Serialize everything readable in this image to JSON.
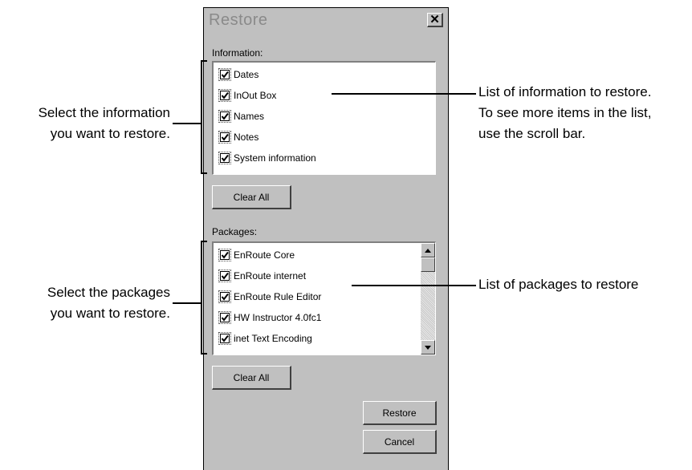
{
  "dialog": {
    "title": "Restore",
    "close_symbol": "✕",
    "close_icon": "close-icon",
    "information": {
      "label": "Information:",
      "items": [
        {
          "label": "Dates",
          "checked": true
        },
        {
          "label": "InOut Box",
          "checked": true
        },
        {
          "label": "Names",
          "checked": true
        },
        {
          "label": "Notes",
          "checked": true
        },
        {
          "label": "System information",
          "checked": true
        }
      ],
      "clear_label": "Clear All"
    },
    "packages": {
      "label": "Packages:",
      "items": [
        {
          "label": "EnRoute  Core",
          "checked": true
        },
        {
          "label": "EnRoute internet",
          "checked": true
        },
        {
          "label": "EnRoute Rule Editor",
          "checked": true
        },
        {
          "label": "HW Instructor 4.0fc1",
          "checked": true
        },
        {
          "label": "inet Text Encoding",
          "checked": true
        }
      ],
      "clear_label": "Clear All"
    },
    "restore_label": "Restore",
    "cancel_label": "Cancel"
  },
  "callouts": {
    "info_left": [
      "Select the information",
      "you want to restore."
    ],
    "info_right": [
      "List of information to restore.",
      "To see more items in the list,",
      "use the scroll bar."
    ],
    "pkg_left": [
      "Select the packages",
      "you want to restore."
    ],
    "pkg_right": [
      "List of packages to restore"
    ]
  }
}
